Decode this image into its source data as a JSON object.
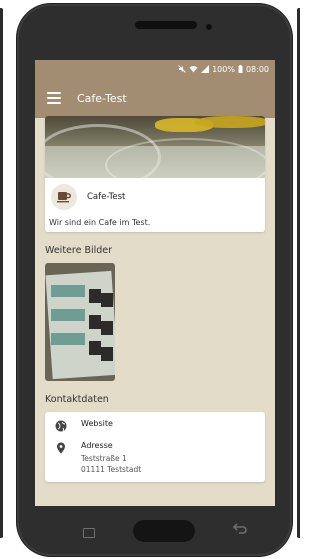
{
  "status_bar": {
    "battery": "100%",
    "time": "08:00"
  },
  "app_bar": {
    "title": "Cafe-Test"
  },
  "hero": {
    "name": "Cafe-Test",
    "description": "Wir sind ein Cafe im Test."
  },
  "sections": {
    "more_images": "Weitere Bilder",
    "contact": "Kontaktdaten"
  },
  "contact": {
    "website_label": "Website",
    "address_label": "Adresse",
    "address_line1": "Teststraße 1",
    "address_line2": "01111 Teststadt"
  },
  "colors": {
    "app_bar": "#a28d72",
    "background": "#e3dcc9",
    "card": "#ffffff"
  },
  "icons": [
    "menu-icon",
    "coffee-cup-icon",
    "globe-icon",
    "location-pin-icon",
    "wifi-icon",
    "signal-icon",
    "battery-icon",
    "mute-icon"
  ]
}
